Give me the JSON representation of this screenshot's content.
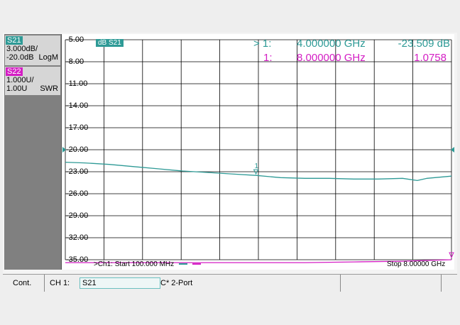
{
  "traces": [
    {
      "name": "S21",
      "scale": "3.000dB/",
      "ref": "-20.0dB",
      "format": "LogM",
      "color": "#2e9a96"
    },
    {
      "name": "S22",
      "scale": "1.000U/",
      "ref": "1.00U",
      "format": "SWR",
      "color": "#d41ec4"
    }
  ],
  "active_trace_tag": "dB S21",
  "y_ticks": [
    "-5.00",
    "-8.00",
    "-11.00",
    "-14.00",
    "-17.00",
    "-20.00",
    "-23.00",
    "-26.00",
    "-29.00",
    "-32.00",
    "-35.00"
  ],
  "markers": [
    {
      "prefix": "> 1:",
      "freq": "4.000000 GHz",
      "value": "-23.509 dB"
    },
    {
      "prefix": "1:",
      "freq": "8.000000 GHz",
      "value": "1.0758"
    }
  ],
  "sweep": {
    "start_label": ">Ch1: Start  100.000 MHz",
    "stop_label": "Stop  8.00000 GHz"
  },
  "status": {
    "mode": "Cont.",
    "channel": "CH 1:",
    "param": "S21",
    "cal": "C* 2-Port"
  },
  "chart_data": {
    "type": "line",
    "xlabel": "",
    "ylabel": "",
    "xlim": [
      0.1,
      8.0
    ],
    "ylim": [
      -35,
      -5
    ],
    "x_unit": "GHz",
    "series": [
      {
        "name": "S21",
        "x": [
          0.1,
          0.5,
          1.0,
          1.5,
          2.0,
          2.5,
          3.0,
          3.5,
          4.0,
          4.5,
          5.0,
          5.5,
          6.0,
          6.5,
          7.0,
          7.3,
          7.5,
          8.0
        ],
        "y": [
          -21.7,
          -21.8,
          -22.0,
          -22.3,
          -22.6,
          -22.9,
          -23.1,
          -23.3,
          -23.5,
          -23.8,
          -23.9,
          -23.9,
          -24.0,
          -24.0,
          -23.9,
          -24.2,
          -23.9,
          -23.6
        ]
      },
      {
        "name": "S22",
        "x": [
          0.1,
          1.0,
          2.0,
          3.0,
          4.0,
          5.0,
          6.0,
          7.0,
          7.5,
          8.0
        ],
        "y": [
          -35.4,
          -35.4,
          -35.4,
          -35.4,
          -35.4,
          -35.4,
          -35.3,
          -35.2,
          -35.1,
          -35.0
        ]
      }
    ]
  }
}
